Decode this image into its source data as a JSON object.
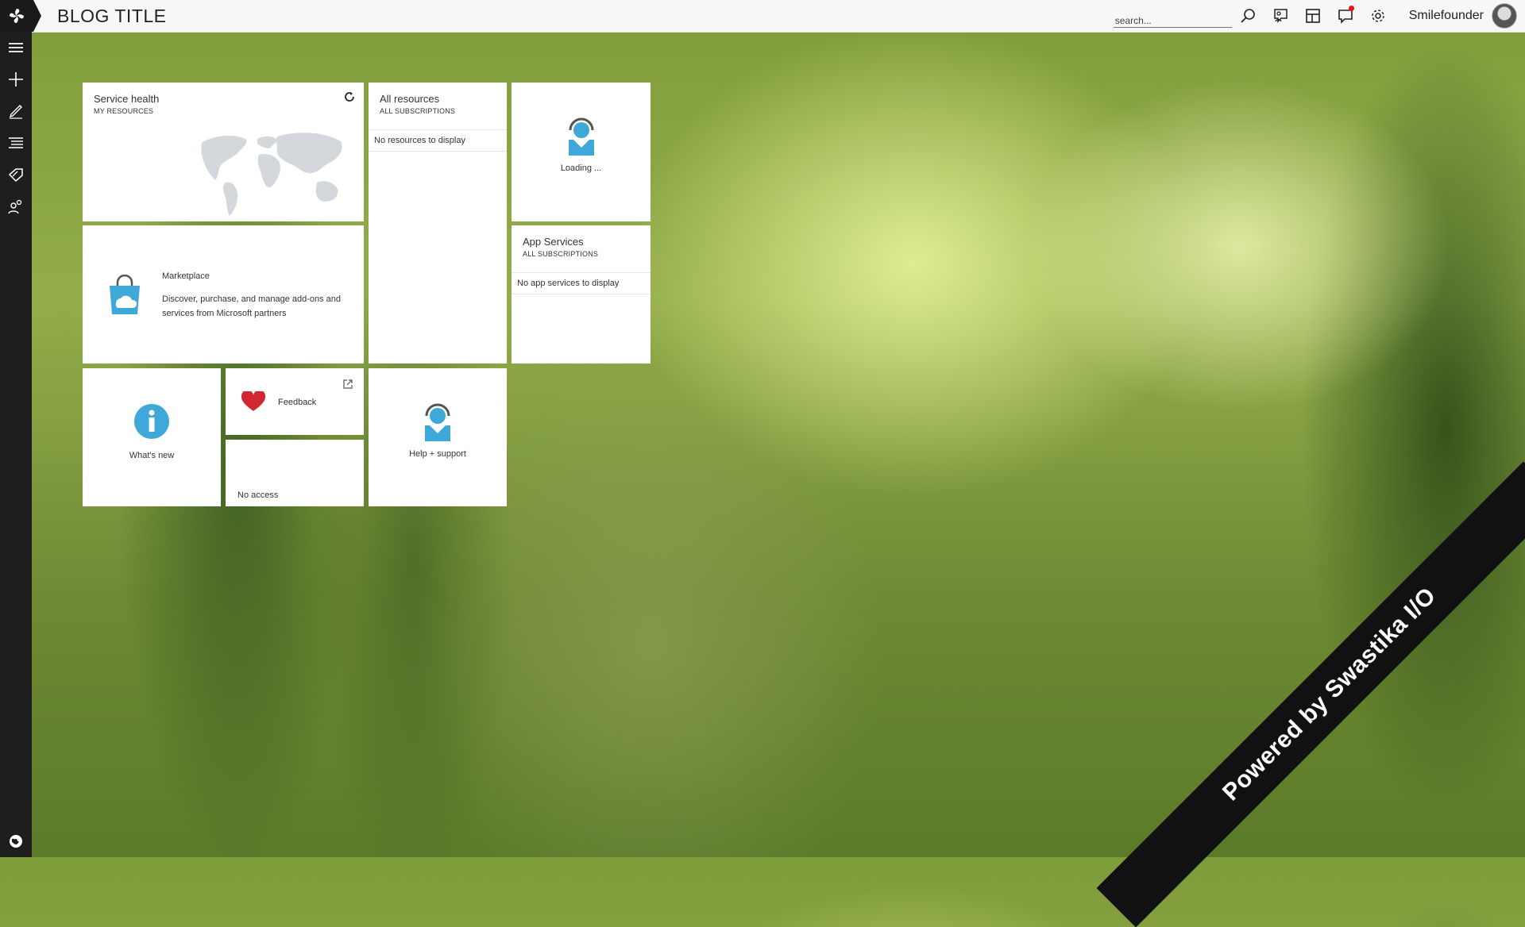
{
  "header": {
    "blog_title": "BLOG TITLE",
    "search_placeholder": "search...",
    "username": "Smilefounder",
    "icons": [
      "search-icon",
      "feedback-icon",
      "dashboard-icon",
      "notifications-icon",
      "settings-icon"
    ]
  },
  "sidebar": {
    "items": [
      "menu-icon",
      "new-icon",
      "edit-icon",
      "list-icon",
      "tag-icon",
      "users-icon"
    ],
    "bottom": "globe-icon"
  },
  "tiles": {
    "service_health": {
      "title": "Service health",
      "subtitle": "MY RESOURCES"
    },
    "all_resources": {
      "title": "All resources",
      "subtitle": "ALL SUBSCRIPTIONS",
      "empty": "No resources to display"
    },
    "loading": {
      "label": "Loading ..."
    },
    "marketplace": {
      "title": "Marketplace",
      "description": "Discover, purchase, and manage add-ons and services from Microsoft partners"
    },
    "app_services": {
      "title": "App Services",
      "subtitle": "ALL SUBSCRIPTIONS",
      "empty": "No app services to display"
    },
    "whats_new": {
      "label": "What's new"
    },
    "feedback": {
      "label": "Feedback"
    },
    "no_access": {
      "label": "No access"
    },
    "help_support": {
      "label": "Help + support"
    }
  },
  "ribbon": {
    "text": "Powered by Swastika I/O"
  },
  "colors": {
    "accent_blue": "#3ea8d8",
    "heart_red": "#d22630",
    "sidebar_bg": "#1e1e1e"
  }
}
